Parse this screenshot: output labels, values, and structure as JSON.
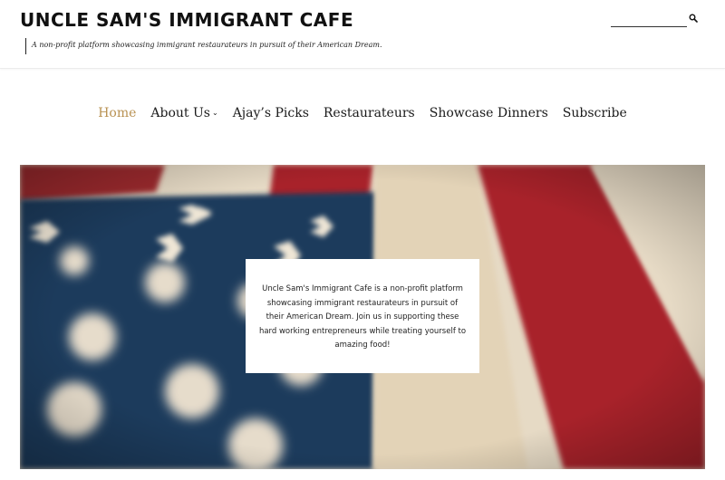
{
  "header": {
    "site_title": "UNCLE SAM'S IMMIGRANT CAFE",
    "tagline": "A non-profit platform showcasing immigrant restaurateurs in pursuit of their American Dream.",
    "search": {
      "placeholder": "",
      "icon": "search-icon"
    }
  },
  "nav": {
    "items": [
      {
        "label": "Home",
        "active": true
      },
      {
        "label": "About Us",
        "has_dropdown": true,
        "chevron": "⌄"
      },
      {
        "label": "Ajay’s Picks"
      },
      {
        "label": "Restaurateurs"
      },
      {
        "label": "Showcase Dinners"
      },
      {
        "label": "Subscribe"
      }
    ]
  },
  "hero": {
    "text": "Uncle Sam's Immigrant Cafe is a non-profit platform showcasing immigrant restaurateurs in pursuit of their American Dream. Join us in supporting these hard working entrepreneurs while treating yourself to amazing food!"
  },
  "colors": {
    "accent": "#b99253",
    "flag_red": "#a8232c",
    "flag_blue": "#1d3a5c",
    "flag_cream": "#e9dfcd"
  }
}
